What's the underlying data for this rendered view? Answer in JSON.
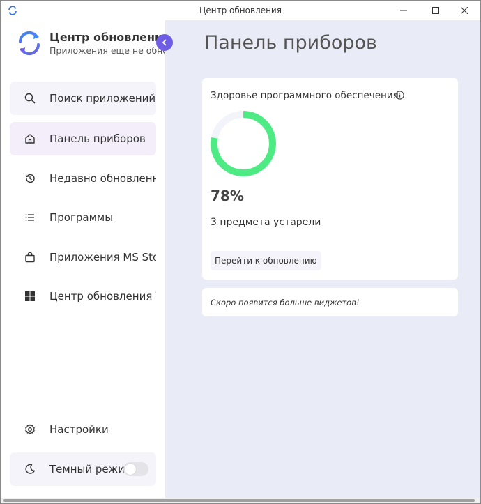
{
  "window": {
    "title": "Центр обновления"
  },
  "sidebar": {
    "brand_title": "Центр обновления",
    "brand_subtitle": "Приложения еще не обновлены!",
    "items": [
      {
        "id": "search",
        "label": "Поиск приложений...",
        "icon": "search-icon"
      },
      {
        "id": "dashboard",
        "label": "Панель приборов",
        "icon": "home-icon",
        "selected": true
      },
      {
        "id": "recent",
        "label": "Недавно обновленные",
        "icon": "history-icon"
      },
      {
        "id": "programs",
        "label": "Программы",
        "icon": "list-icon"
      },
      {
        "id": "msstore",
        "label": "Приложения MS Store",
        "icon": "shopping-bag-icon"
      },
      {
        "id": "winupdate",
        "label": "Центр обновления Windows",
        "icon": "windows-icon"
      }
    ],
    "settings_label": "Настройки",
    "dark_mode_label": "Темный режим",
    "dark_mode_on": false
  },
  "main": {
    "page_title": "Панель приборов",
    "health_card": {
      "title": "Здоровье программного обеспечения",
      "percent_value": 78,
      "percent_text": "78%",
      "outdated_text": "3 предмета устарели",
      "button_label": "Перейти к обновлению"
    },
    "soon_text": "Скоро появится больше виджетов!"
  },
  "colors": {
    "accent": "#6f5de6",
    "ring_progress": "#4eeb85",
    "ring_track": "#f3f3fa",
    "main_bg": "#e9ecf7"
  }
}
